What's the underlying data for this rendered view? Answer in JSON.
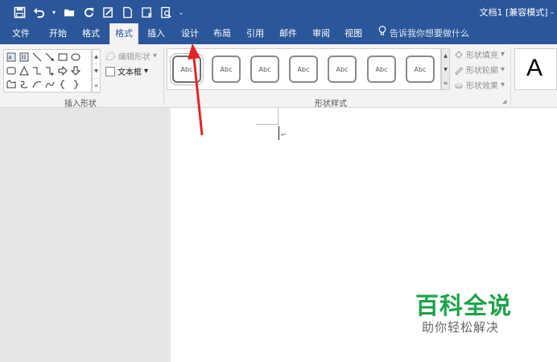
{
  "window": {
    "title": "文档1 [兼容模式] -",
    "qat_more": "⌄"
  },
  "tabs": [
    {
      "label": "文件"
    },
    {
      "label": "开始"
    },
    {
      "label": "格式"
    },
    {
      "label": "格式"
    },
    {
      "label": "插入"
    },
    {
      "label": "设计"
    },
    {
      "label": "布局"
    },
    {
      "label": "引用"
    },
    {
      "label": "邮件"
    },
    {
      "label": "审阅"
    },
    {
      "label": "视图"
    }
  ],
  "tell_me": "告诉我你想要做什么",
  "ribbon": {
    "insert_shapes": {
      "label": "插入形状",
      "edit_shape": "编辑形状",
      "text_box": "文本框"
    },
    "shape_styles": {
      "label": "形状样式",
      "swatch_text": "Abc",
      "fill": "形状填充",
      "outline": "形状轮廓",
      "effects": "形状效果"
    },
    "wordart": {
      "letter": "A"
    }
  },
  "document": {
    "paragraph_mark": "↵"
  },
  "watermark": {
    "main": "百科全说",
    "sub": "助你轻松解决"
  },
  "colors": {
    "accent": "#2b579a",
    "annotation_arrow": "#e02525",
    "watermark_green": "#1aa34a"
  }
}
